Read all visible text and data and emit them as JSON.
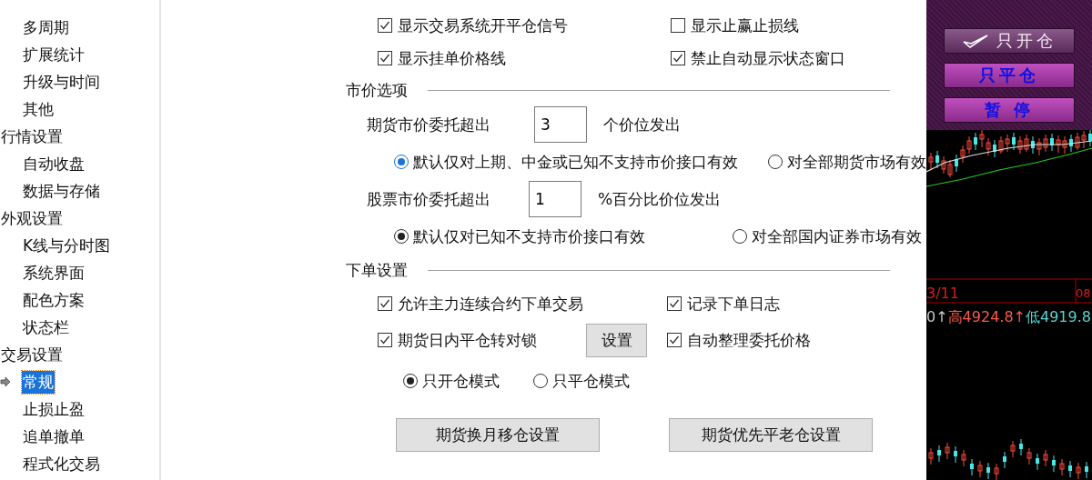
{
  "sidebar": {
    "continued_items": [
      {
        "label": "多周期",
        "selected": false
      },
      {
        "label": "扩展统计",
        "selected": false
      },
      {
        "label": "升级与时间",
        "selected": false
      },
      {
        "label": "其他",
        "selected": false
      }
    ],
    "groups": [
      {
        "label": "行情设置",
        "selected": false,
        "children": [
          {
            "label": "自动收盘",
            "selected": false
          },
          {
            "label": "数据与存储",
            "selected": false
          }
        ]
      },
      {
        "label": "外观设置",
        "selected": false,
        "children": [
          {
            "label": "K线与分时图",
            "selected": false
          },
          {
            "label": "系统界面",
            "selected": false
          },
          {
            "label": "配色方案",
            "selected": false
          },
          {
            "label": "状态栏",
            "selected": false
          }
        ]
      },
      {
        "label": "交易设置",
        "selected": false,
        "children": [
          {
            "label": "常规",
            "selected": true
          },
          {
            "label": "止损止盈",
            "selected": false
          },
          {
            "label": "追单撤单",
            "selected": false
          },
          {
            "label": "程式化交易",
            "selected": false
          }
        ]
      }
    ]
  },
  "display_options": [
    [
      {
        "label": "显示交易系统开平仓信号",
        "checked": true
      },
      {
        "label": "显示止赢止损线",
        "checked": false
      }
    ],
    [
      {
        "label": "显示挂单价格线",
        "checked": true
      },
      {
        "label": "禁止自动显示状态窗口",
        "checked": true
      }
    ]
  ],
  "market_price": {
    "title": "市价选项",
    "futures": {
      "label": "期货市价委托超出",
      "value": "3",
      "suffix": "个价位发出",
      "radios": [
        {
          "label": "默认仅对上期、中金或已知不支持市价接口有效",
          "selected": true
        },
        {
          "label": "对全部期货市场有效",
          "selected": false
        }
      ]
    },
    "stocks": {
      "label": "股票市价委托超出",
      "value": "1",
      "suffix": "%百分比价位发出",
      "radios": [
        {
          "label": "默认仅对已知不支持市价接口有效",
          "selected": true
        },
        {
          "label": "对全部国内证券市场有效",
          "selected": false
        }
      ]
    }
  },
  "order_settings": {
    "title": "下单设置",
    "rows": [
      [
        {
          "label": "允许主力连续合约下单交易",
          "checked": true
        },
        {
          "label": "记录下单日志",
          "checked": true
        }
      ],
      [
        {
          "label": "期货日内平仓转对锁",
          "checked": true,
          "button": "设置"
        },
        {
          "label": "自动整理委托价格",
          "checked": true
        }
      ]
    ],
    "modes": [
      {
        "label": "只开仓模式",
        "selected": true
      },
      {
        "label": "只平仓模式",
        "selected": false
      }
    ],
    "buttons": [
      "期货换月移仓设置",
      "期货优先平老仓设置"
    ]
  },
  "trade_panel": {
    "buttons": [
      {
        "label": "只开仓",
        "selected": true
      },
      {
        "label": "只平仓",
        "selected": false
      },
      {
        "label": "暂 停",
        "selected": false
      }
    ]
  },
  "chart_labels": {
    "date": "3/11",
    "date_next": "08",
    "info": [
      {
        "text": "0↑",
        "color": "#c8c8c8"
      },
      {
        "text": "高4924.8↑",
        "color": "#ff5a4a"
      },
      {
        "text": "低4919.8",
        "color": "#5ad2d2"
      }
    ]
  }
}
